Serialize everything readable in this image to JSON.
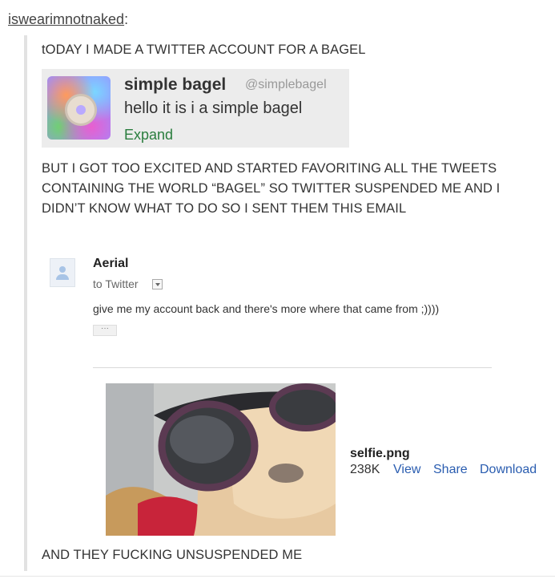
{
  "post": {
    "username": "iswearimnotnaked",
    "username_suffix": ":",
    "line1": "tODAY I MADE A TWITTER ACCOUNT FOR A BAGEL",
    "para2": "BUT I GOT TOO EXCITED AND STARTED FAVORITING ALL THE TWEETS CONTAINING THE WORLD “BAGEL” SO TWITTER SUSPENDED ME AND I DIDN’T KNOW WHAT TO DO SO I SENT THEM THIS EMAIL",
    "para3": "AND THEY FUCKING UNSUSPENDED ME"
  },
  "tweet": {
    "name": "simple bagel",
    "handle": "@simplebagel",
    "text": "hello it is i a simple bagel",
    "expand": "Expand"
  },
  "email": {
    "sender": "Aerial",
    "to": "to Twitter",
    "body": "give me my account back and there's more where that came from ;))))",
    "ellipsis": "···"
  },
  "attachment": {
    "filename": "selfie.png",
    "size": "238K",
    "view": "View",
    "share": "Share",
    "download": "Download"
  },
  "icons": {
    "avatar": "person-icon",
    "dropdown": "chevron-down-icon"
  },
  "colors": {
    "link": "#2a5db0",
    "expand": "#2a7d3e",
    "text": "#333333"
  }
}
